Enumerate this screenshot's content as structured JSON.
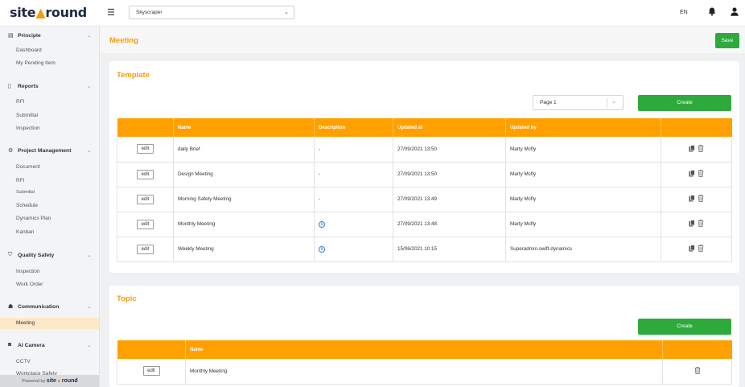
{
  "brand": {
    "logo_part1": "site",
    "logo_part2": "round",
    "powered_prefix": "Powered by",
    "accent_color": "#ffa000",
    "title_color": "#f39c12",
    "create_color": "#2eaa3d"
  },
  "topbar": {
    "project": "Skyscraper",
    "language": "EN"
  },
  "sidebar": {
    "sections": [
      {
        "label": "Principle",
        "icon": "list-icon",
        "items": [
          "Dashboard",
          "My Pending Item"
        ]
      },
      {
        "label": "Reports",
        "icon": "clipboard-icon",
        "items": [
          "RFI",
          "Submittal",
          "Inspection"
        ]
      },
      {
        "label": "Project Management",
        "icon": "gears-icon",
        "items": [
          "Document",
          "RFI",
          "Submittal",
          "Schedule",
          "Dynamics Plan",
          "Kanban"
        ]
      },
      {
        "label": "Quality Safety",
        "icon": "shield-icon",
        "items": [
          "Inspection",
          "Work Order"
        ]
      },
      {
        "label": "Communication",
        "icon": "users-icon",
        "items": [
          "Meeting"
        ]
      },
      {
        "label": "AI Camera",
        "icon": "camera-icon",
        "items": [
          "CCTV",
          "Workplace Safety"
        ]
      }
    ],
    "active_item": "Meeting"
  },
  "main": {
    "title": "Meeting",
    "save_label": "Save"
  },
  "template": {
    "title": "Template",
    "page_value": "Page 1",
    "create_label": "Create",
    "columns": [
      "",
      "Name",
      "Description",
      "Updated at",
      "Updated by",
      ""
    ],
    "edit_label": "edit",
    "rows": [
      {
        "name": "daily Brief",
        "description": "-",
        "updated_at": "27/09/2021 13:50",
        "updated_by": "Marty Mcfly"
      },
      {
        "name": "Design Meeting",
        "description": "-",
        "updated_at": "27/09/2021 13:50",
        "updated_by": "Marty Mcfly"
      },
      {
        "name": "Morning Safety Meeting",
        "description": "-",
        "updated_at": "27/09/2021 13:49",
        "updated_by": "Marty Mcfly"
      },
      {
        "name": "Monthly Meeting",
        "description": "info",
        "updated_at": "27/09/2021 13:48",
        "updated_by": "Marty Mcfly"
      },
      {
        "name": "Weekly Meeting",
        "description": "info",
        "updated_at": "15/06/2021 10:15",
        "updated_by": "Superadmin.swift-dynamics"
      }
    ]
  },
  "topic": {
    "title": "Topic",
    "create_label": "Create",
    "columns": [
      "",
      "Name",
      ""
    ],
    "edit_label": "edit",
    "rows": [
      {
        "name": "Monthly Meeting"
      }
    ]
  }
}
